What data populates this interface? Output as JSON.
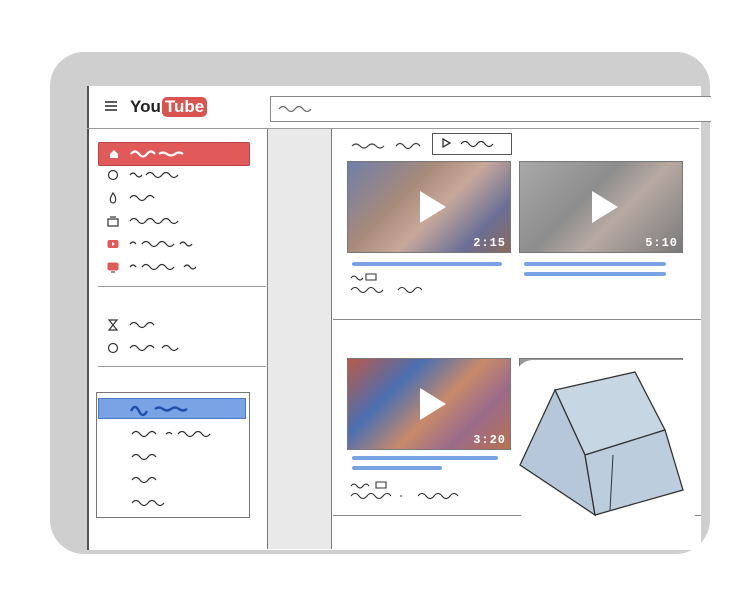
{
  "app": {
    "logo_you": "You",
    "logo_tube": "Tube"
  },
  "videos": [
    {
      "duration": "2:15"
    },
    {
      "duration": "5:10"
    },
    {
      "duration": "3:20"
    },
    {
      "duration": ""
    }
  ],
  "colors": {
    "accent_red": "#e05a5a",
    "accent_blue": "#7aa3e6",
    "frame_gray": "#cfcfcf",
    "gutter_gray": "#e9e9e9"
  },
  "icons": [
    "menu-icon",
    "home-icon",
    "trending-icon",
    "fire-icon",
    "subscriptions-icon",
    "video-icon",
    "tv-icon",
    "hourglass-icon",
    "clock-icon",
    "play-icon"
  ]
}
